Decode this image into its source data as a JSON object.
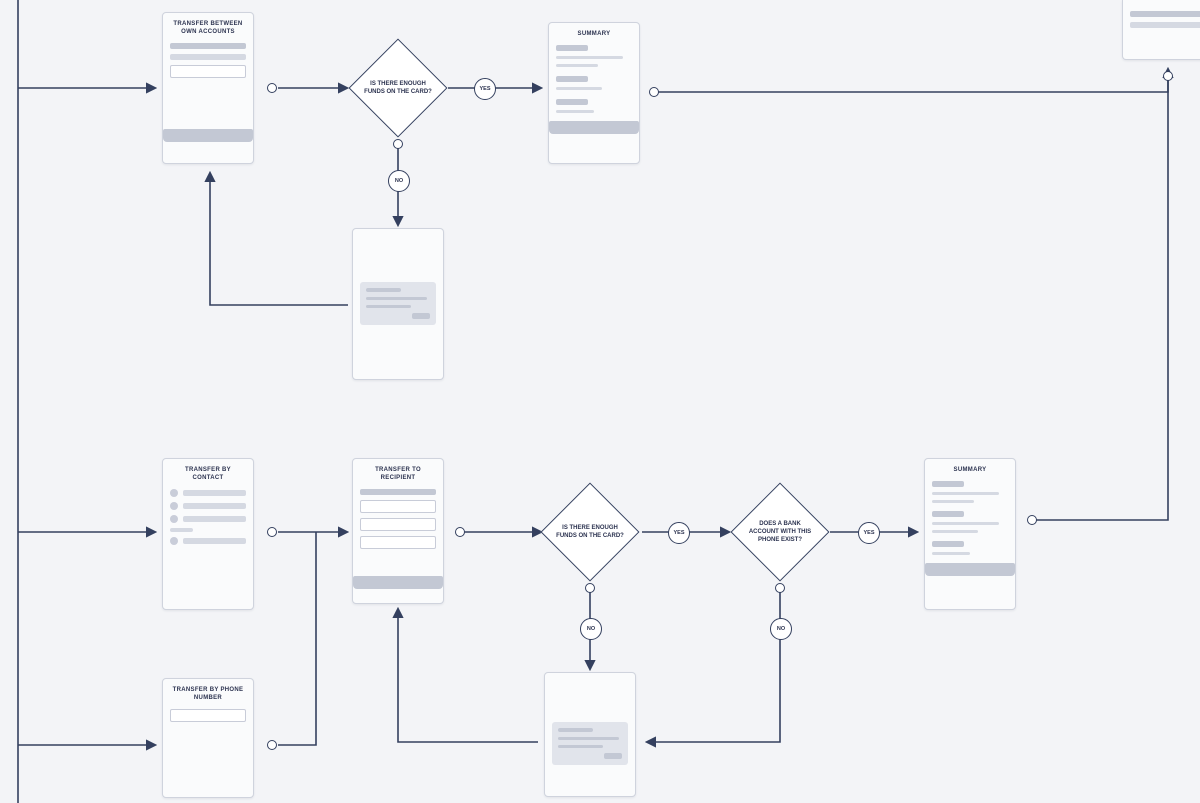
{
  "screens": {
    "transfer_own": {
      "title": "TRANSFER BETWEEN OWN ACCOUNTS"
    },
    "transfer_contact": {
      "title": "TRANSFER BY CONTACT"
    },
    "transfer_phone": {
      "title": "TRANSFER BY PHONE NUMBER"
    },
    "transfer_recip": {
      "title": "TRANSFER TO RECIPIENT"
    },
    "summary1": {
      "title": "SUMMARY"
    },
    "summary2": {
      "title": "SUMMARY"
    }
  },
  "decisions": {
    "funds1": "IS THERE ENOUGH FUNDS ON THE CARD?",
    "funds2": "IS THERE ENOUGH FUNDS ON THE CARD?",
    "bank_exists": "DOES A BANK ACCOUNT WITH THIS PHONE EXIST?"
  },
  "badges": {
    "yes": "YES",
    "no": "NO"
  }
}
